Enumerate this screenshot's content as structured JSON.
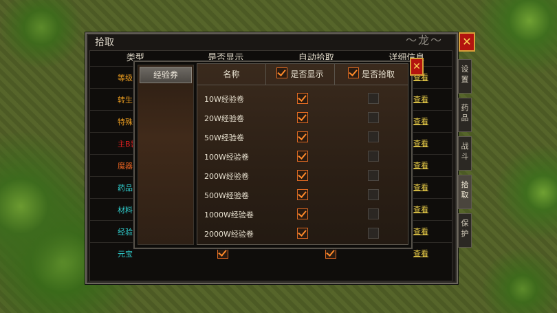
{
  "main": {
    "title": "拾取",
    "deco_text": "～龙～",
    "close_label": "✕",
    "headers": [
      "类型",
      "是否显示",
      "自动拾取",
      "详细信息"
    ],
    "rows": [
      {
        "category": "等级装",
        "color": "#f0a020",
        "show": true,
        "pick": true,
        "detail": "查看"
      },
      {
        "category": "转生装",
        "color": "#f0a020",
        "show": true,
        "pick": true,
        "detail": "查看"
      },
      {
        "category": "特殊装",
        "color": "#f0a020",
        "show": true,
        "pick": true,
        "detail": "查看"
      },
      {
        "category": "主B装",
        "color": "#e02020",
        "show": true,
        "pick": true,
        "detail": "查看"
      },
      {
        "category": "魔器",
        "color": "#e06020",
        "show": true,
        "pick": true,
        "detail": "查看"
      },
      {
        "category": "药品",
        "color": "#30d0d0",
        "show": true,
        "pick": true,
        "detail": "查看"
      },
      {
        "category": "材料",
        "color": "#30d0d0",
        "show": true,
        "pick": true,
        "detail": "查看"
      },
      {
        "category": "经验券",
        "color": "#30d0d0",
        "show": true,
        "pick": true,
        "detail": "查看"
      },
      {
        "category": "元宝",
        "color": "#30d0d0",
        "show": true,
        "pick": true,
        "detail": "查看"
      }
    ]
  },
  "side_tabs": [
    {
      "label": "设置",
      "active": false
    },
    {
      "label": "药品",
      "active": false
    },
    {
      "label": "战斗",
      "active": false
    },
    {
      "label": "拾取",
      "active": true
    },
    {
      "label": "保护",
      "active": false
    }
  ],
  "popup": {
    "category_tab": "经验券",
    "close_label": "✕",
    "col_name": "名称",
    "col_show": "是否显示",
    "col_pick": "是否拾取",
    "items": [
      {
        "name": "10W经验卷",
        "show": true,
        "pick": false
      },
      {
        "name": "20W经验卷",
        "show": true,
        "pick": false
      },
      {
        "name": "50W经验卷",
        "show": true,
        "pick": false
      },
      {
        "name": "100W经验卷",
        "show": true,
        "pick": false
      },
      {
        "name": "200W经验卷",
        "show": true,
        "pick": false
      },
      {
        "name": "500W经验卷",
        "show": true,
        "pick": false
      },
      {
        "name": "1000W经验卷",
        "show": true,
        "pick": false
      },
      {
        "name": "2000W经验卷",
        "show": true,
        "pick": false
      }
    ]
  }
}
